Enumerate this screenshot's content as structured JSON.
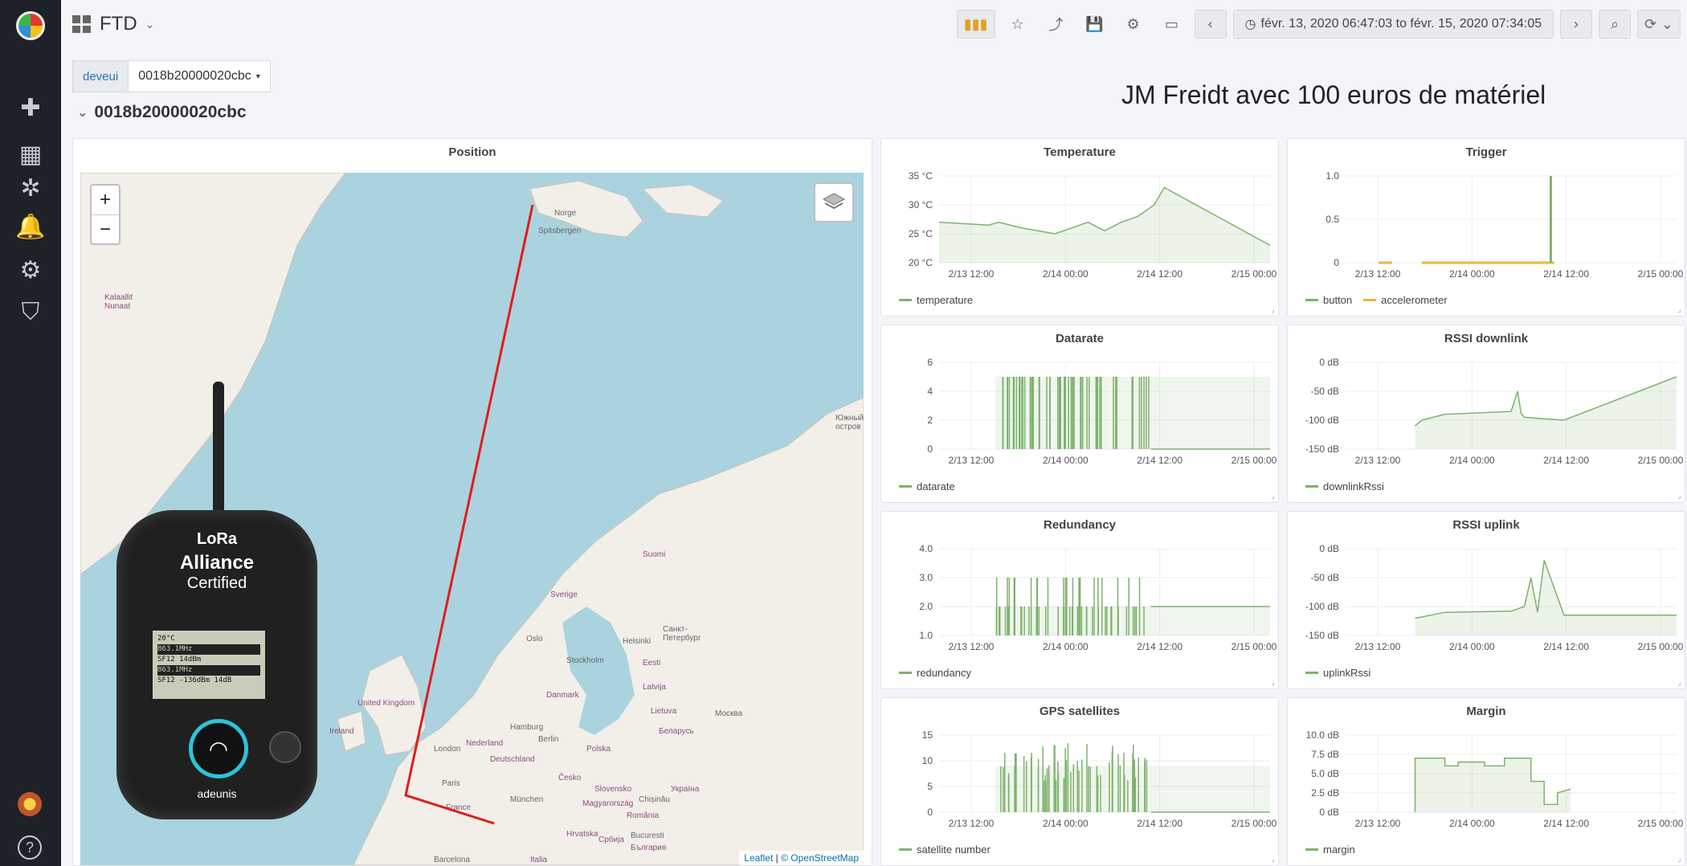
{
  "sidebar": {
    "icons": [
      "plus-icon",
      "dashboards-icon",
      "explore-icon",
      "alert-bell-icon",
      "gear-icon",
      "shield-icon"
    ],
    "help_glyph": "?"
  },
  "header": {
    "dashboard_title": "FTD",
    "time_range": "févr. 13, 2020 06:47:03 to févr. 15, 2020 07:34:05"
  },
  "variable": {
    "label": "deveui",
    "value": "0018b20000020cbc"
  },
  "row_title": "0018b20000020cbc",
  "caption": "JM Freidt avec 100 euros de matériel",
  "map_panel": {
    "title": "Position",
    "zoom_in": "+",
    "zoom_out": "−",
    "attribution_leaflet": "Leaflet",
    "attribution_osm": "© OpenStreetMap",
    "labels": [
      "Norge",
      "Spitsbergen",
      "Kalaallit Nunaat",
      "Suomi",
      "Sverige",
      "Oslo",
      "Stockholm",
      "Helsinki",
      "Санкт-Петербург",
      "Eesti",
      "Latvija",
      "Lietuva",
      "Danmark",
      "United Kingdom",
      "Ireland",
      "London",
      "Nederland",
      "Berlin",
      "Hamburg",
      "Polska",
      "Беларусь",
      "Москва",
      "Deutschland",
      "Paris",
      "France",
      "München",
      "Česko",
      "Slovensko",
      "Україна",
      "Magyarország",
      "Chișinău",
      "România",
      "Bucuresti",
      "Hrvatska",
      "Србија",
      "България",
      "Italia",
      "Barcelona",
      "Южный остров"
    ]
  },
  "device": {
    "brand_line1": "LoRa",
    "brand_line2": "Alliance",
    "brand_line3": "Certified",
    "screen_line1": "20°C",
    "screen_line2": "863.1MHz",
    "screen_line3": "SF12 14dBm",
    "screen_line4": "863.1MHz",
    "screen_line5": "SF12 -136dBm 14dB",
    "maker": "adeunis"
  },
  "chart_data": [
    {
      "name": "temperature-panel",
      "title": "Temperature",
      "type": "area",
      "y_ticks": [
        "35 °C",
        "30 °C",
        "25 °C",
        "20 °C"
      ],
      "x_ticks": [
        "2/13 12:00",
        "2/14 00:00",
        "2/14 12:00",
        "2/15 00:00"
      ],
      "ylim": [
        20,
        35
      ],
      "series": [
        {
          "name": "temperature",
          "color": "#7eb26d",
          "x": [
            0.0,
            0.15,
            0.18,
            0.25,
            0.3,
            0.35,
            0.4,
            0.45,
            0.5,
            0.55,
            0.6,
            0.65,
            0.68,
            1.0
          ],
          "y": [
            27,
            26.5,
            27,
            26,
            25.5,
            25,
            26,
            27,
            25.5,
            27,
            28,
            30,
            33,
            23
          ]
        }
      ],
      "x_start_frac": 0.17
    },
    {
      "name": "trigger-panel",
      "title": "Trigger",
      "type": "line",
      "y_ticks": [
        "1.0",
        "0.5",
        "0"
      ],
      "x_ticks": [
        "2/13 12:00",
        "2/14 00:00",
        "2/14 12:00",
        "2/15 00:00"
      ],
      "ylim": [
        0,
        1
      ],
      "series": [
        {
          "name": "button",
          "color": "#7eb26d",
          "spike_frac": 0.62
        },
        {
          "name": "accelerometer",
          "color": "#eab839",
          "segments": [
            [
              0.1,
              0.14
            ],
            [
              0.23,
              0.63
            ]
          ]
        }
      ]
    },
    {
      "name": "datarate-panel",
      "title": "Datarate",
      "type": "line",
      "y_ticks": [
        "6",
        "4",
        "2",
        "0"
      ],
      "x_ticks": [
        "2/13 12:00",
        "2/14 00:00",
        "2/14 12:00",
        "2/15 00:00"
      ],
      "ylim": [
        0,
        6
      ],
      "series": [
        {
          "name": "datarate",
          "color": "#7eb26d",
          "busy_from": 0.17,
          "busy_to": 0.64,
          "high": 5,
          "low": 0
        }
      ]
    },
    {
      "name": "rssi-downlink-panel",
      "title": "RSSI downlink",
      "type": "line",
      "y_ticks": [
        "0 dB",
        "-50 dB",
        "-100 dB",
        "-150 dB"
      ],
      "x_ticks": [
        "2/13 12:00",
        "2/14 00:00",
        "2/14 12:00",
        "2/15 00:00"
      ],
      "ylim": [
        -150,
        0
      ],
      "series": [
        {
          "name": "downlinkRssi",
          "color": "#7eb26d",
          "x": [
            0.21,
            0.23,
            0.3,
            0.5,
            0.52,
            0.53,
            0.54,
            0.58,
            0.66,
            1.0
          ],
          "y": [
            -110,
            -100,
            -90,
            -85,
            -50,
            -88,
            -95,
            -97,
            -100,
            -25
          ]
        }
      ]
    },
    {
      "name": "redundancy-panel",
      "title": "Redundancy",
      "type": "line",
      "y_ticks": [
        "4.0",
        "3.0",
        "2.0",
        "1.0"
      ],
      "x_ticks": [
        "2/13 12:00",
        "2/14 00:00",
        "2/14 12:00",
        "2/15 00:00"
      ],
      "ylim": [
        1,
        4
      ],
      "series": [
        {
          "name": "redundancy",
          "color": "#7eb26d",
          "busy_from": 0.17,
          "busy_to": 0.64,
          "base": 1,
          "plateau": 2
        }
      ]
    },
    {
      "name": "rssi-uplink-panel",
      "title": "RSSI uplink",
      "type": "line",
      "y_ticks": [
        "0 dB",
        "-50 dB",
        "-100 dB",
        "-150 dB"
      ],
      "x_ticks": [
        "2/13 12:00",
        "2/14 00:00",
        "2/14 12:00",
        "2/15 00:00"
      ],
      "ylim": [
        -150,
        0
      ],
      "series": [
        {
          "name": "uplinkRssi",
          "color": "#7eb26d",
          "x": [
            0.21,
            0.23,
            0.3,
            0.5,
            0.54,
            0.56,
            0.58,
            0.6,
            0.66,
            1.0
          ],
          "y": [
            -120,
            -118,
            -110,
            -108,
            -100,
            -50,
            -110,
            -20,
            -115,
            -115
          ]
        }
      ]
    },
    {
      "name": "gps-panel",
      "title": "GPS satellites",
      "type": "line",
      "y_ticks": [
        "15",
        "10",
        "5",
        "0"
      ],
      "x_ticks": [
        "2/13 12:00",
        "2/14 00:00",
        "2/14 12:00",
        "2/15 00:00"
      ],
      "ylim": [
        0,
        15
      ],
      "series": [
        {
          "name": "satellite number",
          "color": "#7eb26d",
          "busy_from": 0.17,
          "busy_to": 0.64
        }
      ]
    },
    {
      "name": "margin-panel",
      "title": "Margin",
      "type": "line",
      "y_ticks": [
        "10.0 dB",
        "7.5 dB",
        "5.0 dB",
        "2.5 dB",
        "0 dB"
      ],
      "x_ticks": [
        "2/13 12:00",
        "2/14 00:00",
        "2/14 12:00",
        "2/15 00:00"
      ],
      "ylim": [
        0,
        10
      ],
      "series": [
        {
          "name": "margin",
          "color": "#7eb26d",
          "x": [
            0.21,
            0.21,
            0.3,
            0.3,
            0.34,
            0.34,
            0.42,
            0.42,
            0.48,
            0.48,
            0.56,
            0.56,
            0.6,
            0.6,
            0.64,
            0.64,
            0.68
          ],
          "y": [
            0,
            7,
            7,
            6,
            6,
            6.5,
            6.5,
            6,
            6,
            7,
            7,
            4,
            4,
            1,
            1,
            2.5,
            3
          ]
        }
      ]
    }
  ]
}
